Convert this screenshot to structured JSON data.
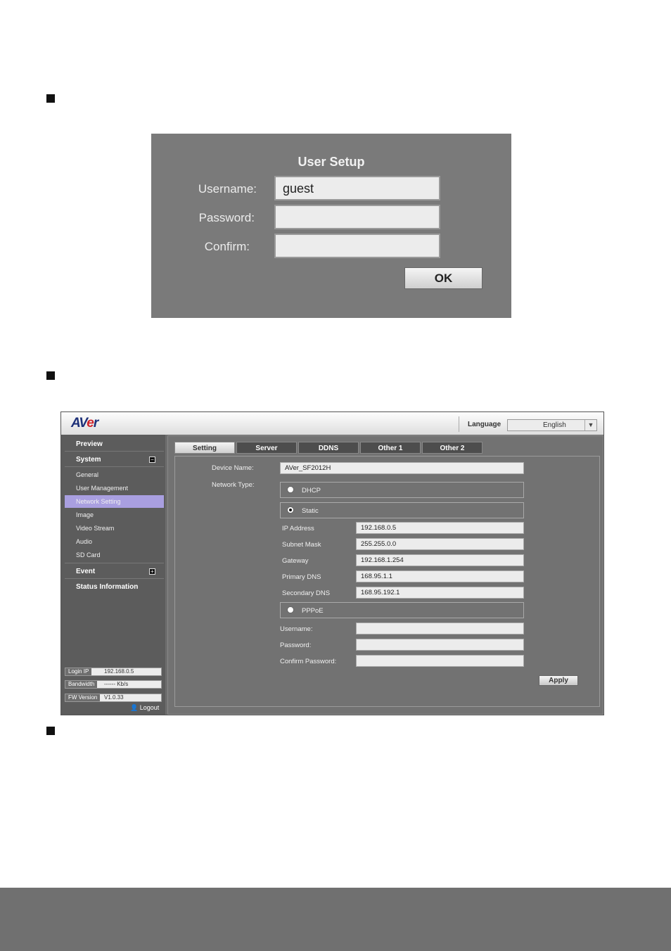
{
  "user_setup": {
    "title": "User Setup",
    "username_label": "Username:",
    "username_value": "guest",
    "password_label": "Password:",
    "confirm_label": "Confirm:",
    "ok_label": "OK"
  },
  "web_ui": {
    "logo_a": "AV",
    "logo_e": "e",
    "logo_r": "r",
    "language_label": "Language",
    "language_value": "English",
    "sidebar": {
      "preview": "Preview",
      "system": "System",
      "system_items": [
        "General",
        "User Management",
        "Network Setting",
        "Image",
        "Video Stream",
        "Audio",
        "SD Card"
      ],
      "event": "Event",
      "status": "Status Information",
      "login_ip_label": "Login IP",
      "login_ip_value": "192.168.0.5",
      "bandwidth_label": "Bandwidth",
      "bandwidth_value": "------ Kb/s",
      "fw_label": "FW Version",
      "fw_value": "V1.0.33",
      "logout": "Logout"
    },
    "tabs": [
      "Setting",
      "Server",
      "DDNS",
      "Other 1",
      "Other 2"
    ],
    "form": {
      "device_name_label": "Device Name:",
      "device_name_value": "AVer_SF2012H",
      "network_type_label": "Network Type:",
      "dhcp_label": "DHCP",
      "static_label": "Static",
      "ip_label": "IP Address",
      "ip_value": "192.168.0.5",
      "subnet_label": "Subnet Mask",
      "subnet_value": "255.255.0.0",
      "gateway_label": "Gateway",
      "gateway_value": "192.168.1.254",
      "dns1_label": "Primary DNS",
      "dns1_value": "168.95.1.1",
      "dns2_label": "Secondary DNS",
      "dns2_value": "168.95.192.1",
      "pppoe_label": "PPPoE",
      "username_label": "Username:",
      "password_label": "Password:",
      "confirm_password_label": "Confirm Password:",
      "apply_label": "Apply"
    }
  }
}
